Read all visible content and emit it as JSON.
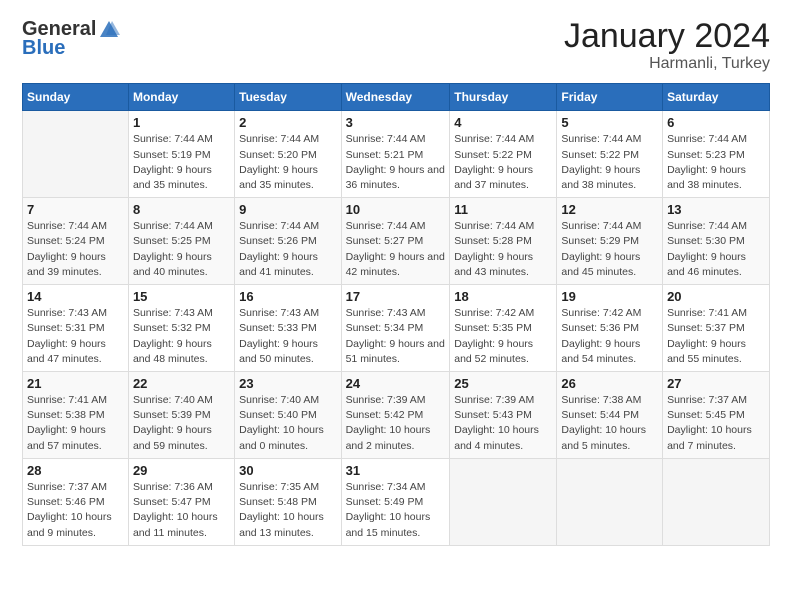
{
  "header": {
    "logo_general": "General",
    "logo_blue": "Blue",
    "main_title": "January 2024",
    "subtitle": "Harmanli, Turkey"
  },
  "days_of_week": [
    "Sunday",
    "Monday",
    "Tuesday",
    "Wednesday",
    "Thursday",
    "Friday",
    "Saturday"
  ],
  "weeks": [
    [
      {
        "day": "",
        "sunrise": "",
        "sunset": "",
        "daylight": ""
      },
      {
        "day": "1",
        "sunrise": "Sunrise: 7:44 AM",
        "sunset": "Sunset: 5:19 PM",
        "daylight": "Daylight: 9 hours and 35 minutes."
      },
      {
        "day": "2",
        "sunrise": "Sunrise: 7:44 AM",
        "sunset": "Sunset: 5:20 PM",
        "daylight": "Daylight: 9 hours and 35 minutes."
      },
      {
        "day": "3",
        "sunrise": "Sunrise: 7:44 AM",
        "sunset": "Sunset: 5:21 PM",
        "daylight": "Daylight: 9 hours and 36 minutes."
      },
      {
        "day": "4",
        "sunrise": "Sunrise: 7:44 AM",
        "sunset": "Sunset: 5:22 PM",
        "daylight": "Daylight: 9 hours and 37 minutes."
      },
      {
        "day": "5",
        "sunrise": "Sunrise: 7:44 AM",
        "sunset": "Sunset: 5:22 PM",
        "daylight": "Daylight: 9 hours and 38 minutes."
      },
      {
        "day": "6",
        "sunrise": "Sunrise: 7:44 AM",
        "sunset": "Sunset: 5:23 PM",
        "daylight": "Daylight: 9 hours and 38 minutes."
      }
    ],
    [
      {
        "day": "7",
        "sunrise": "Sunrise: 7:44 AM",
        "sunset": "Sunset: 5:24 PM",
        "daylight": "Daylight: 9 hours and 39 minutes."
      },
      {
        "day": "8",
        "sunrise": "Sunrise: 7:44 AM",
        "sunset": "Sunset: 5:25 PM",
        "daylight": "Daylight: 9 hours and 40 minutes."
      },
      {
        "day": "9",
        "sunrise": "Sunrise: 7:44 AM",
        "sunset": "Sunset: 5:26 PM",
        "daylight": "Daylight: 9 hours and 41 minutes."
      },
      {
        "day": "10",
        "sunrise": "Sunrise: 7:44 AM",
        "sunset": "Sunset: 5:27 PM",
        "daylight": "Daylight: 9 hours and 42 minutes."
      },
      {
        "day": "11",
        "sunrise": "Sunrise: 7:44 AM",
        "sunset": "Sunset: 5:28 PM",
        "daylight": "Daylight: 9 hours and 43 minutes."
      },
      {
        "day": "12",
        "sunrise": "Sunrise: 7:44 AM",
        "sunset": "Sunset: 5:29 PM",
        "daylight": "Daylight: 9 hours and 45 minutes."
      },
      {
        "day": "13",
        "sunrise": "Sunrise: 7:44 AM",
        "sunset": "Sunset: 5:30 PM",
        "daylight": "Daylight: 9 hours and 46 minutes."
      }
    ],
    [
      {
        "day": "14",
        "sunrise": "Sunrise: 7:43 AM",
        "sunset": "Sunset: 5:31 PM",
        "daylight": "Daylight: 9 hours and 47 minutes."
      },
      {
        "day": "15",
        "sunrise": "Sunrise: 7:43 AM",
        "sunset": "Sunset: 5:32 PM",
        "daylight": "Daylight: 9 hours and 48 minutes."
      },
      {
        "day": "16",
        "sunrise": "Sunrise: 7:43 AM",
        "sunset": "Sunset: 5:33 PM",
        "daylight": "Daylight: 9 hours and 50 minutes."
      },
      {
        "day": "17",
        "sunrise": "Sunrise: 7:43 AM",
        "sunset": "Sunset: 5:34 PM",
        "daylight": "Daylight: 9 hours and 51 minutes."
      },
      {
        "day": "18",
        "sunrise": "Sunrise: 7:42 AM",
        "sunset": "Sunset: 5:35 PM",
        "daylight": "Daylight: 9 hours and 52 minutes."
      },
      {
        "day": "19",
        "sunrise": "Sunrise: 7:42 AM",
        "sunset": "Sunset: 5:36 PM",
        "daylight": "Daylight: 9 hours and 54 minutes."
      },
      {
        "day": "20",
        "sunrise": "Sunrise: 7:41 AM",
        "sunset": "Sunset: 5:37 PM",
        "daylight": "Daylight: 9 hours and 55 minutes."
      }
    ],
    [
      {
        "day": "21",
        "sunrise": "Sunrise: 7:41 AM",
        "sunset": "Sunset: 5:38 PM",
        "daylight": "Daylight: 9 hours and 57 minutes."
      },
      {
        "day": "22",
        "sunrise": "Sunrise: 7:40 AM",
        "sunset": "Sunset: 5:39 PM",
        "daylight": "Daylight: 9 hours and 59 minutes."
      },
      {
        "day": "23",
        "sunrise": "Sunrise: 7:40 AM",
        "sunset": "Sunset: 5:40 PM",
        "daylight": "Daylight: 10 hours and 0 minutes."
      },
      {
        "day": "24",
        "sunrise": "Sunrise: 7:39 AM",
        "sunset": "Sunset: 5:42 PM",
        "daylight": "Daylight: 10 hours and 2 minutes."
      },
      {
        "day": "25",
        "sunrise": "Sunrise: 7:39 AM",
        "sunset": "Sunset: 5:43 PM",
        "daylight": "Daylight: 10 hours and 4 minutes."
      },
      {
        "day": "26",
        "sunrise": "Sunrise: 7:38 AM",
        "sunset": "Sunset: 5:44 PM",
        "daylight": "Daylight: 10 hours and 5 minutes."
      },
      {
        "day": "27",
        "sunrise": "Sunrise: 7:37 AM",
        "sunset": "Sunset: 5:45 PM",
        "daylight": "Daylight: 10 hours and 7 minutes."
      }
    ],
    [
      {
        "day": "28",
        "sunrise": "Sunrise: 7:37 AM",
        "sunset": "Sunset: 5:46 PM",
        "daylight": "Daylight: 10 hours and 9 minutes."
      },
      {
        "day": "29",
        "sunrise": "Sunrise: 7:36 AM",
        "sunset": "Sunset: 5:47 PM",
        "daylight": "Daylight: 10 hours and 11 minutes."
      },
      {
        "day": "30",
        "sunrise": "Sunrise: 7:35 AM",
        "sunset": "Sunset: 5:48 PM",
        "daylight": "Daylight: 10 hours and 13 minutes."
      },
      {
        "day": "31",
        "sunrise": "Sunrise: 7:34 AM",
        "sunset": "Sunset: 5:49 PM",
        "daylight": "Daylight: 10 hours and 15 minutes."
      },
      {
        "day": "",
        "sunrise": "",
        "sunset": "",
        "daylight": ""
      },
      {
        "day": "",
        "sunrise": "",
        "sunset": "",
        "daylight": ""
      },
      {
        "day": "",
        "sunrise": "",
        "sunset": "",
        "daylight": ""
      }
    ]
  ]
}
